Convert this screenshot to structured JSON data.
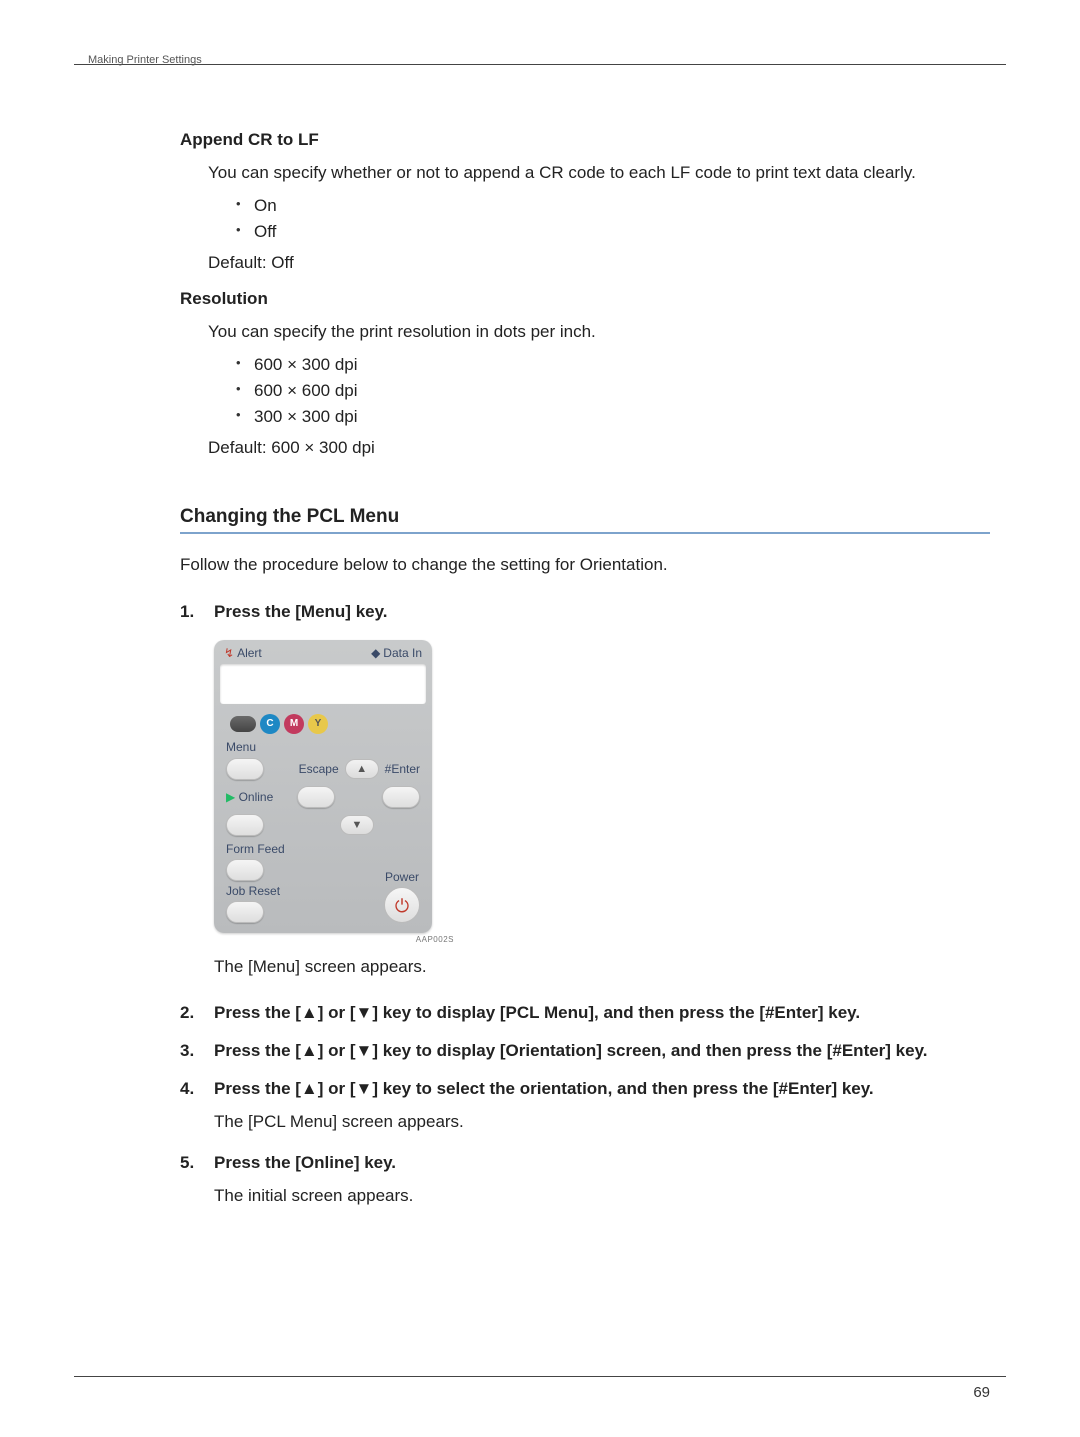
{
  "header": {
    "running_head": "Making Printer Settings"
  },
  "sections": {
    "append": {
      "title": "Append CR to LF",
      "desc": "You can specify whether or not to append a CR code to each LF code to print text data clearly.",
      "items": [
        "On",
        "Off"
      ],
      "default": "Default: Off"
    },
    "resolution": {
      "title": "Resolution",
      "desc": "You can specify the print resolution in dots per inch.",
      "items": [
        "600 × 300 dpi",
        "600 × 600 dpi",
        "300 × 300 dpi"
      ],
      "default": "Default: 600 × 300 dpi"
    }
  },
  "heading": "Changing the PCL Menu",
  "intro": "Follow the procedure below to change the setting for Orientation.",
  "steps": [
    {
      "num": "1.",
      "title": "Press the [Menu] key.",
      "after": "The [Menu] screen appears."
    },
    {
      "num": "2.",
      "title": "Press the [▲] or [▼] key to display [PCL Menu], and then press the [#Enter] key."
    },
    {
      "num": "3.",
      "title": "Press the [▲] or [▼] key to display [Orientation] screen, and then press the [#Enter] key."
    },
    {
      "num": "4.",
      "title": "Press the [▲] or [▼] key to select the orientation, and then press the [#Enter] key.",
      "after": "The [PCL Menu] screen appears."
    },
    {
      "num": "5.",
      "title": "Press the [Online] key.",
      "after": "The initial screen appears."
    }
  ],
  "panel": {
    "alert": "Alert",
    "data_in": "Data In",
    "toner": {
      "c": "C",
      "m": "M",
      "y": "Y"
    },
    "menu": "Menu",
    "escape": "Escape",
    "enter": "#Enter",
    "online": "Online",
    "form_feed": "Form Feed",
    "job_reset": "Job Reset",
    "power": "Power",
    "arrow_up": "▲",
    "arrow_down": "▼",
    "power_symbol": "⏻",
    "caption": "AAP002S"
  },
  "page_number": "69"
}
